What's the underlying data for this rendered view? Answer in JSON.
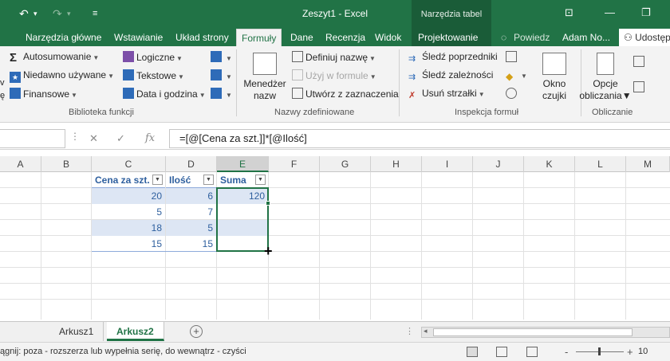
{
  "titlebar": {
    "title": "Zeszyt1 - Excel",
    "context_group": "Narzędzia tabel"
  },
  "tabs": {
    "home": "Narzędzia główne",
    "insert": "Wstawianie",
    "layout": "Układ strony",
    "formulas": "Formuły",
    "data": "Dane",
    "review": "Recenzja",
    "view": "Widok",
    "design": "Projektowanie",
    "tell_me": "Powiedz",
    "user": "Adam No...",
    "share": "Udostęp"
  },
  "ribbon": {
    "autosum": "Autosumowanie",
    "recent": "Niedawno używane",
    "financial": "Finansowe",
    "logical": "Logiczne",
    "text": "Tekstowe",
    "datetime": "Data i godzina",
    "group_library": "Biblioteka funkcji",
    "name_manager_1": "Menedżer",
    "name_manager_2": "nazw",
    "define_name": "Definiuj nazwę",
    "use_in_formula": "Użyj w formule",
    "create_from_selection": "Utwórz z zaznaczenia",
    "group_names": "Nazwy zdefiniowane",
    "trace_precedents": "Śledź poprzedniki",
    "trace_dependents": "Śledź zależności",
    "remove_arrows": "Usuń strzałki",
    "watch_window_1": "Okno",
    "watch_window_2": "czujki",
    "group_audit": "Inspekcja formuł",
    "calc_options_1": "Opcje",
    "calc_options_2": "obliczania",
    "group_calc": "Obliczanie",
    "left_cut_1": "v",
    "left_cut_2": "ę"
  },
  "formula_bar": {
    "formula": "=[@[Cena za szt.]]*[@Ilość]",
    "fx": "fx"
  },
  "columns": [
    "A",
    "B",
    "C",
    "D",
    "E",
    "F",
    "G",
    "H",
    "I",
    "J",
    "K",
    "L",
    "M"
  ],
  "table": {
    "headers": [
      "Cena za szt.",
      "Ilość",
      "Suma"
    ],
    "rows": [
      [
        "20",
        "6",
        "120"
      ],
      [
        "5",
        "7",
        ""
      ],
      [
        "18",
        "5",
        ""
      ],
      [
        "15",
        "15",
        ""
      ]
    ]
  },
  "sheets": {
    "sheet1": "Arkusz1",
    "sheet2": "Arkusz2",
    "add": "+"
  },
  "status": {
    "message": "ągnij: poza - rozszerza lub wypełnia serię, do wewnątrz - czyści",
    "zoom_minus": "-",
    "zoom_plus": "+",
    "zoom_label": "10"
  },
  "colors": {
    "accent": "#217346",
    "table_text": "#2e5f9e",
    "band": "#dde6f4"
  }
}
